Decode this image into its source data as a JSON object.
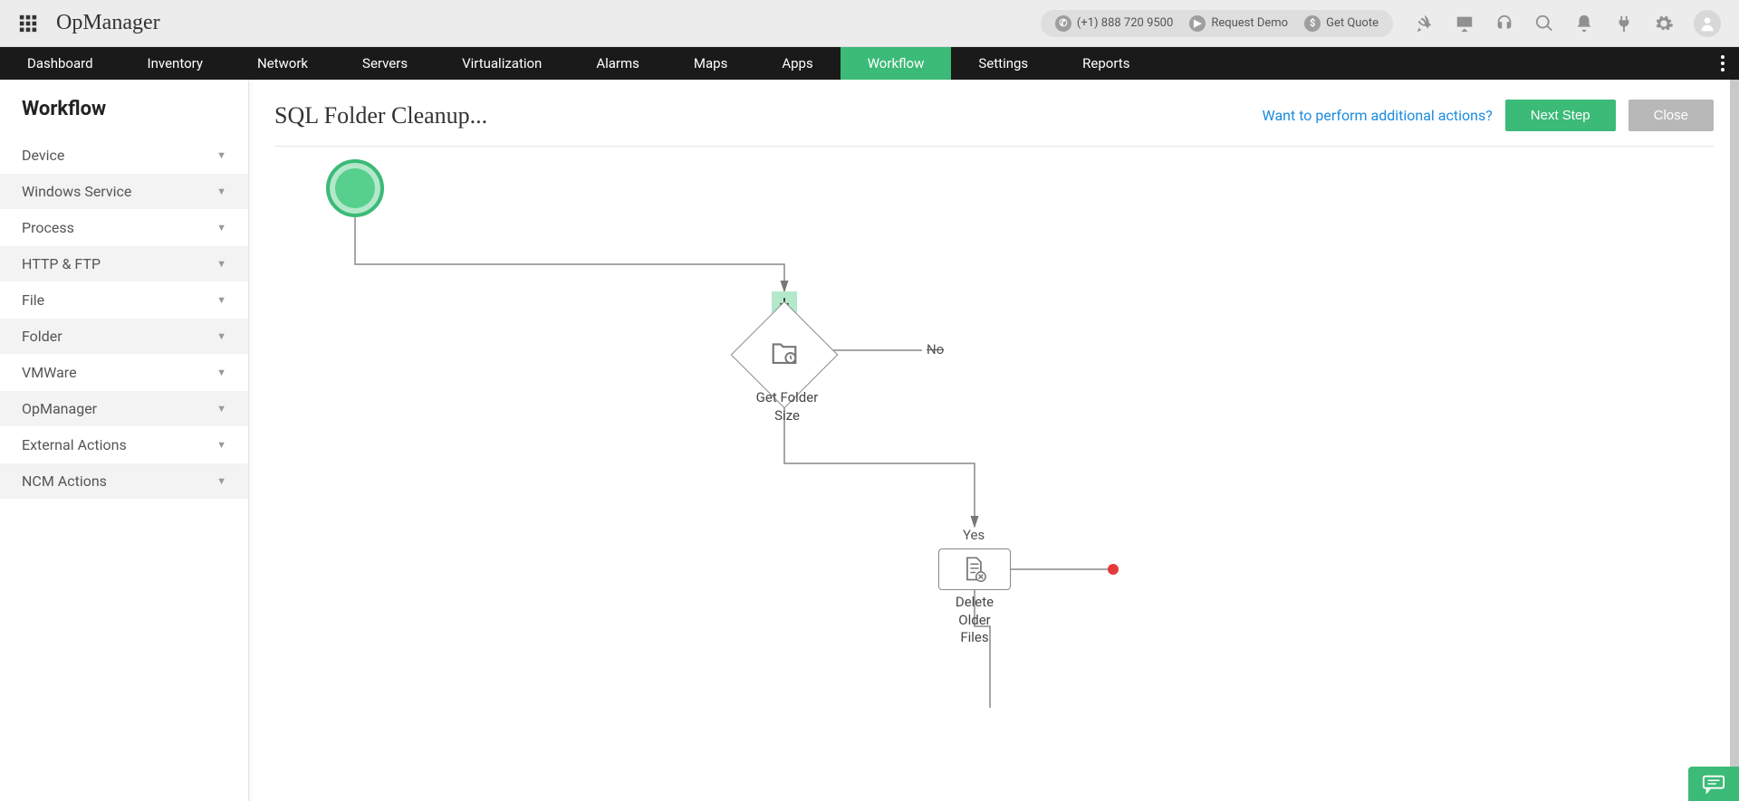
{
  "header": {
    "brand": "OpManager",
    "phone": "(+1) 888 720 9500",
    "request_demo": "Request Demo",
    "get_quote": "Get Quote"
  },
  "nav": {
    "items": [
      "Dashboard",
      "Inventory",
      "Network",
      "Servers",
      "Virtualization",
      "Alarms",
      "Maps",
      "Apps",
      "Workflow",
      "Settings",
      "Reports"
    ],
    "active_index": 8
  },
  "sidebar": {
    "title": "Workflow",
    "items": [
      "Device",
      "Windows Service",
      "Process",
      "HTTP & FTP",
      "File",
      "Folder",
      "VMWare",
      "OpManager",
      "External Actions",
      "NCM Actions"
    ]
  },
  "content": {
    "title": "SQL Folder Cleanup...",
    "additional_actions": "Want to perform additional actions?",
    "next_step": "Next Step",
    "close": "Close"
  },
  "flow": {
    "node1_label": "Get Folder Size",
    "node1_no": "No",
    "node2_yes": "Yes",
    "node2_label": "Delete Older Files"
  }
}
